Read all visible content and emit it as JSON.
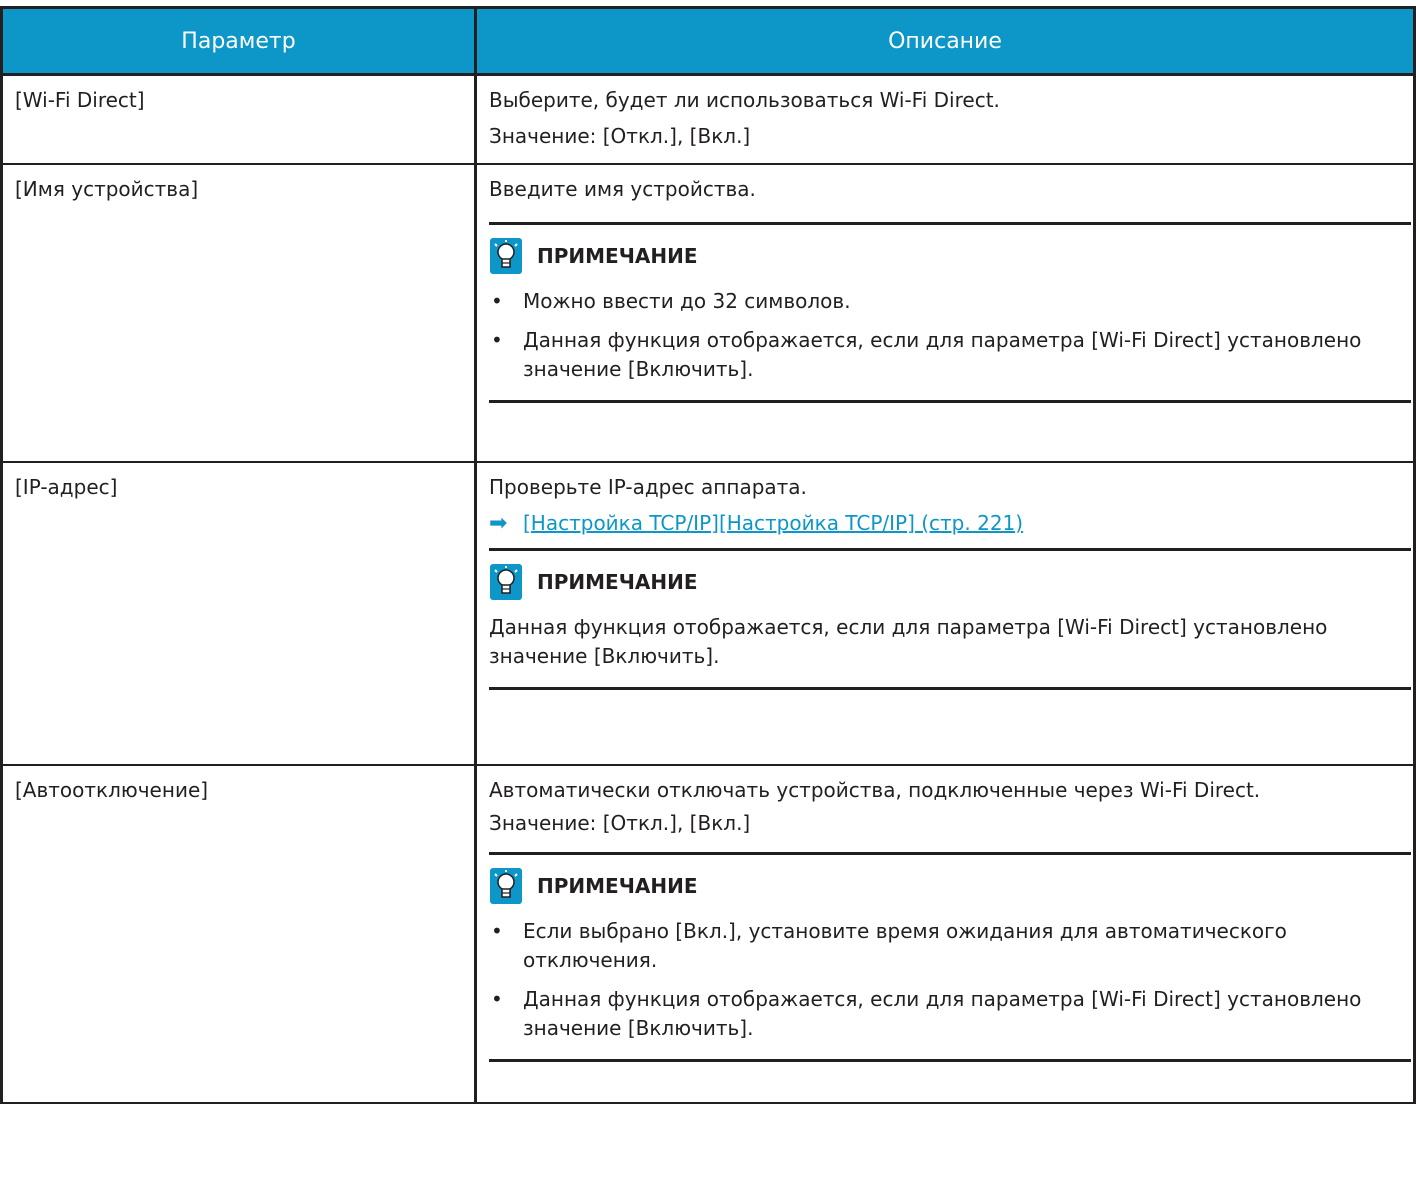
{
  "headers": {
    "param": "Параметр",
    "desc": "Описание"
  },
  "rows": [
    {
      "param": "[Wi-Fi Direct]",
      "lines": [
        "Выберите, будет ли использоваться Wi-Fi Direct.",
        "Значение: [Откл.], [Вкл.]"
      ]
    },
    {
      "param": "[Имя устройства]",
      "lines": [
        "Введите имя устройства."
      ],
      "note_title": "ПРИМЕЧАНИЕ",
      "note_items": [
        "Можно ввести до 32 символов.",
        "Данная функция отображается, если для параметра [Wi-Fi Direct] установлено значение [Включить]."
      ]
    },
    {
      "param": "[IP-адрес]",
      "lines": [
        "Проверьте IP-адрес аппарата."
      ],
      "link": "[Настройка TCP/IP][Настройка TCP/IP] (стр. 221)",
      "note_title": "ПРИМЕЧАНИЕ",
      "note_text": "Данная функция отображается, если для параметра [Wi-Fi Direct] установлено значение [Включить]."
    },
    {
      "param": "[Автоотключение]",
      "lines": [
        "Автоматически отключать устройства, подключенные через Wi-Fi Direct.",
        "Значение: [Откл.], [Вкл.]"
      ],
      "note_title": "ПРИМЕЧАНИЕ",
      "note_items": [
        "Если выбрано [Вкл.], установите время ожидания для автоматического отключения.",
        "Данная функция отображается, если для параметра [Wi-Fi Direct] установлено значение [Включить]."
      ]
    }
  ],
  "icons": {
    "note": "lightbulb-note-icon",
    "arrow": "arrow-right-icon",
    "bullet": "•"
  },
  "colors": {
    "header_bg": "#0d96c8",
    "link": "#0d96c8",
    "text": "#231f20"
  }
}
